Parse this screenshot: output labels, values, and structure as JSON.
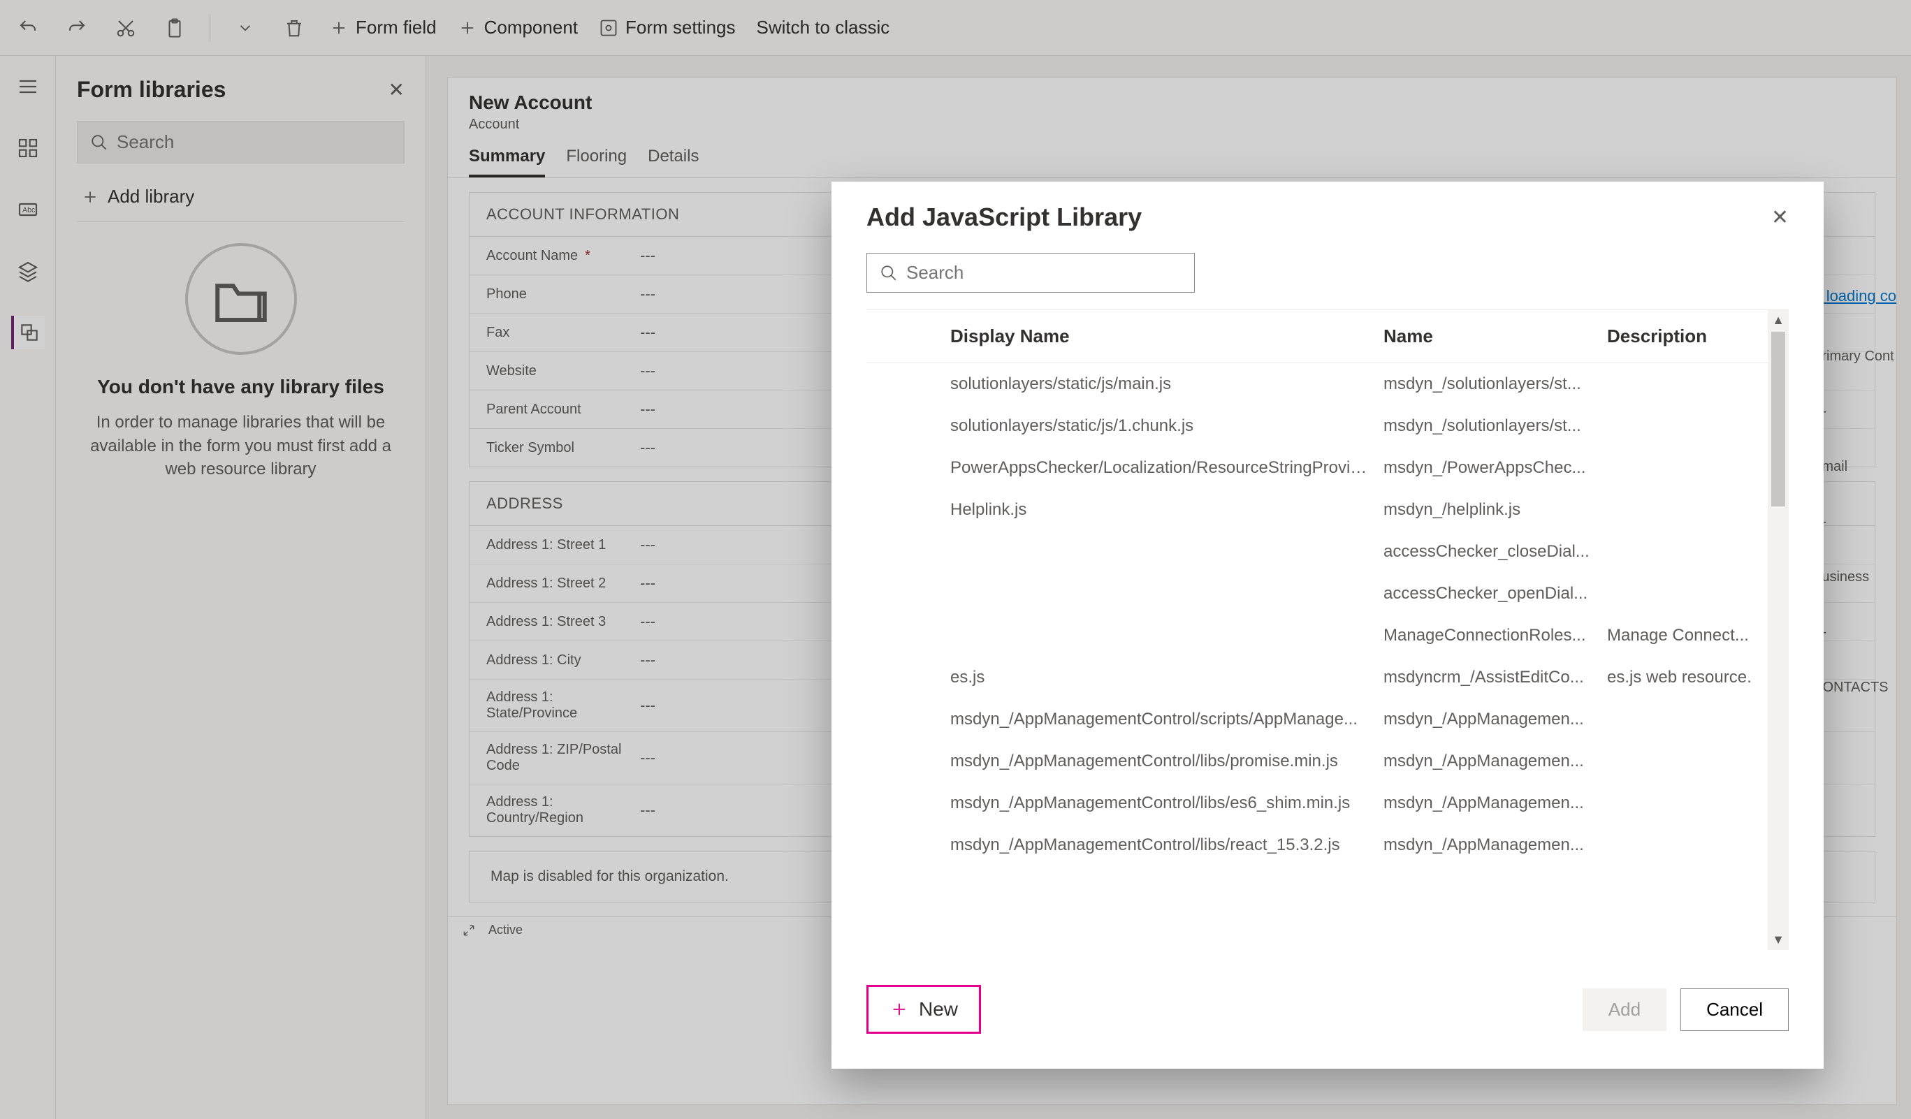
{
  "toolbar": {
    "form_field": "Form field",
    "component": "Component",
    "form_settings": "Form settings",
    "switch_classic": "Switch to classic"
  },
  "side_panel": {
    "title": "Form libraries",
    "search_placeholder": "Search",
    "add_library": "Add library",
    "empty_title": "You don't have any library files",
    "empty_text": "In order to manage libraries that will be available in the form you must first add a web resource library"
  },
  "canvas": {
    "title": "New Account",
    "entity": "Account",
    "tabs": [
      "Summary",
      "Flooring",
      "Details"
    ],
    "active_tab": 0,
    "sections": [
      {
        "title": "ACCOUNT INFORMATION",
        "rows": [
          {
            "label": "Account Name",
            "required": true,
            "value": "---"
          },
          {
            "label": "Phone",
            "required": false,
            "value": "---"
          },
          {
            "label": "Fax",
            "required": false,
            "value": "---"
          },
          {
            "label": "Website",
            "required": false,
            "value": "---"
          },
          {
            "label": "Parent Account",
            "required": false,
            "value": "---"
          },
          {
            "label": "Ticker Symbol",
            "required": false,
            "value": "---"
          }
        ]
      },
      {
        "title": "ADDRESS",
        "rows": [
          {
            "label": "Address 1: Street 1",
            "required": false,
            "value": "---"
          },
          {
            "label": "Address 1: Street 2",
            "required": false,
            "value": "---"
          },
          {
            "label": "Address 1: Street 3",
            "required": false,
            "value": "---"
          },
          {
            "label": "Address 1: City",
            "required": false,
            "value": "---"
          },
          {
            "label": "Address 1: State/Province",
            "required": false,
            "value": "---"
          },
          {
            "label": "Address 1: ZIP/Postal Code",
            "required": false,
            "value": "---"
          },
          {
            "label": "Address 1: Country/Region",
            "required": false,
            "value": "---"
          }
        ]
      }
    ],
    "map_note": "Map is disabled for this organization.",
    "status": "Active",
    "right_frags": {
      "primary_contact": "Primary Cont",
      "primary_contact_val": "---",
      "email": "Email",
      "email_val": "---",
      "business": "Business",
      "business_val": "---",
      "contacts": "CONTACTS"
    },
    "loading_link": "r loading co"
  },
  "dialog": {
    "title": "Add JavaScript Library",
    "search_placeholder": "Search",
    "columns": {
      "c1": "Display Name",
      "c2": "Name",
      "c3": "Description"
    },
    "rows": [
      {
        "display": "solutionlayers/static/js/main.js",
        "name": "msdyn_/solutionlayers/st...",
        "desc": ""
      },
      {
        "display": "solutionlayers/static/js/1.chunk.js",
        "name": "msdyn_/solutionlayers/st...",
        "desc": ""
      },
      {
        "display": "PowerAppsChecker/Localization/ResourceStringProvid...",
        "name": "msdyn_/PowerAppsChec...",
        "desc": ""
      },
      {
        "display": "Helplink.js",
        "name": "msdyn_/helplink.js",
        "desc": ""
      },
      {
        "display": "",
        "name": "accessChecker_closeDial...",
        "desc": ""
      },
      {
        "display": "",
        "name": "accessChecker_openDial...",
        "desc": ""
      },
      {
        "display": "",
        "name": "ManageConnectionRoles...",
        "desc": "Manage Connect..."
      },
      {
        "display": "es.js",
        "name": "msdyncrm_/AssistEditCo...",
        "desc": "es.js web resource."
      },
      {
        "display": "msdyn_/AppManagementControl/scripts/AppManage...",
        "name": "msdyn_/AppManagemen...",
        "desc": ""
      },
      {
        "display": "msdyn_/AppManagementControl/libs/promise.min.js",
        "name": "msdyn_/AppManagemen...",
        "desc": ""
      },
      {
        "display": "msdyn_/AppManagementControl/libs/es6_shim.min.js",
        "name": "msdyn_/AppManagemen...",
        "desc": ""
      },
      {
        "display": "msdyn_/AppManagementControl/libs/react_15.3.2.js",
        "name": "msdyn_/AppManagemen...",
        "desc": ""
      }
    ],
    "new_btn": "New",
    "add_btn": "Add",
    "cancel_btn": "Cancel"
  }
}
